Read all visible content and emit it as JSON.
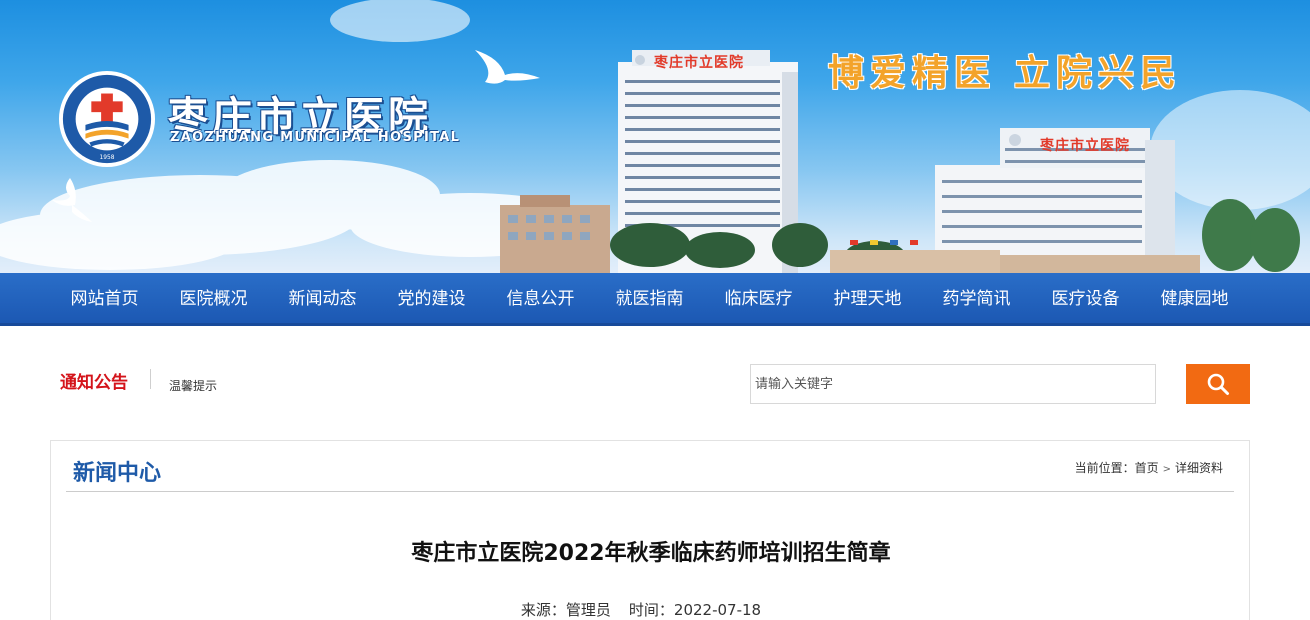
{
  "banner": {
    "hospital_name_cn": "枣庄市立医院",
    "hospital_name_en": "ZAOZHUANG MUNICIPAL HOSPITAL",
    "slogan_left": "博爱精医",
    "slogan_right": "立院兴民",
    "building_sign_left": "枣庄市立医院",
    "building_sign_right": "枣庄市立医院",
    "logo_ring_text": "枣庄市立医院 ZAOZHUANG MUNICIPAL HOSPITAL",
    "logo_year": "1958"
  },
  "nav": {
    "items": [
      {
        "label": "网站首页"
      },
      {
        "label": "医院概况"
      },
      {
        "label": "新闻动态"
      },
      {
        "label": "党的建设"
      },
      {
        "label": "信息公开"
      },
      {
        "label": "就医指南"
      },
      {
        "label": "临床医疗"
      },
      {
        "label": "护理天地"
      },
      {
        "label": "药学简讯"
      },
      {
        "label": "医疗设备"
      },
      {
        "label": "健康园地"
      }
    ]
  },
  "notice": {
    "title": "通知公告",
    "text": "温馨提示"
  },
  "search": {
    "placeholder": "请输入关键字",
    "value": ""
  },
  "section": {
    "title": "新闻中心",
    "breadcrumb_prefix": "当前位置：",
    "breadcrumb_home": "首页",
    "breadcrumb_sep": ">",
    "breadcrumb_current": "详细资料"
  },
  "article": {
    "title": "枣庄市立医院2022年秋季临床药师培训招生简章",
    "source_label": "来源：",
    "source": "管理员",
    "time_label": "时间：",
    "time": "2022-07-18"
  },
  "colors": {
    "nav_bg": "#1c58b3",
    "notice_red": "#d4141b",
    "search_orange": "#f26a12",
    "section_blue": "#1e5aa8",
    "slogan_orange": "#f3a32a"
  }
}
